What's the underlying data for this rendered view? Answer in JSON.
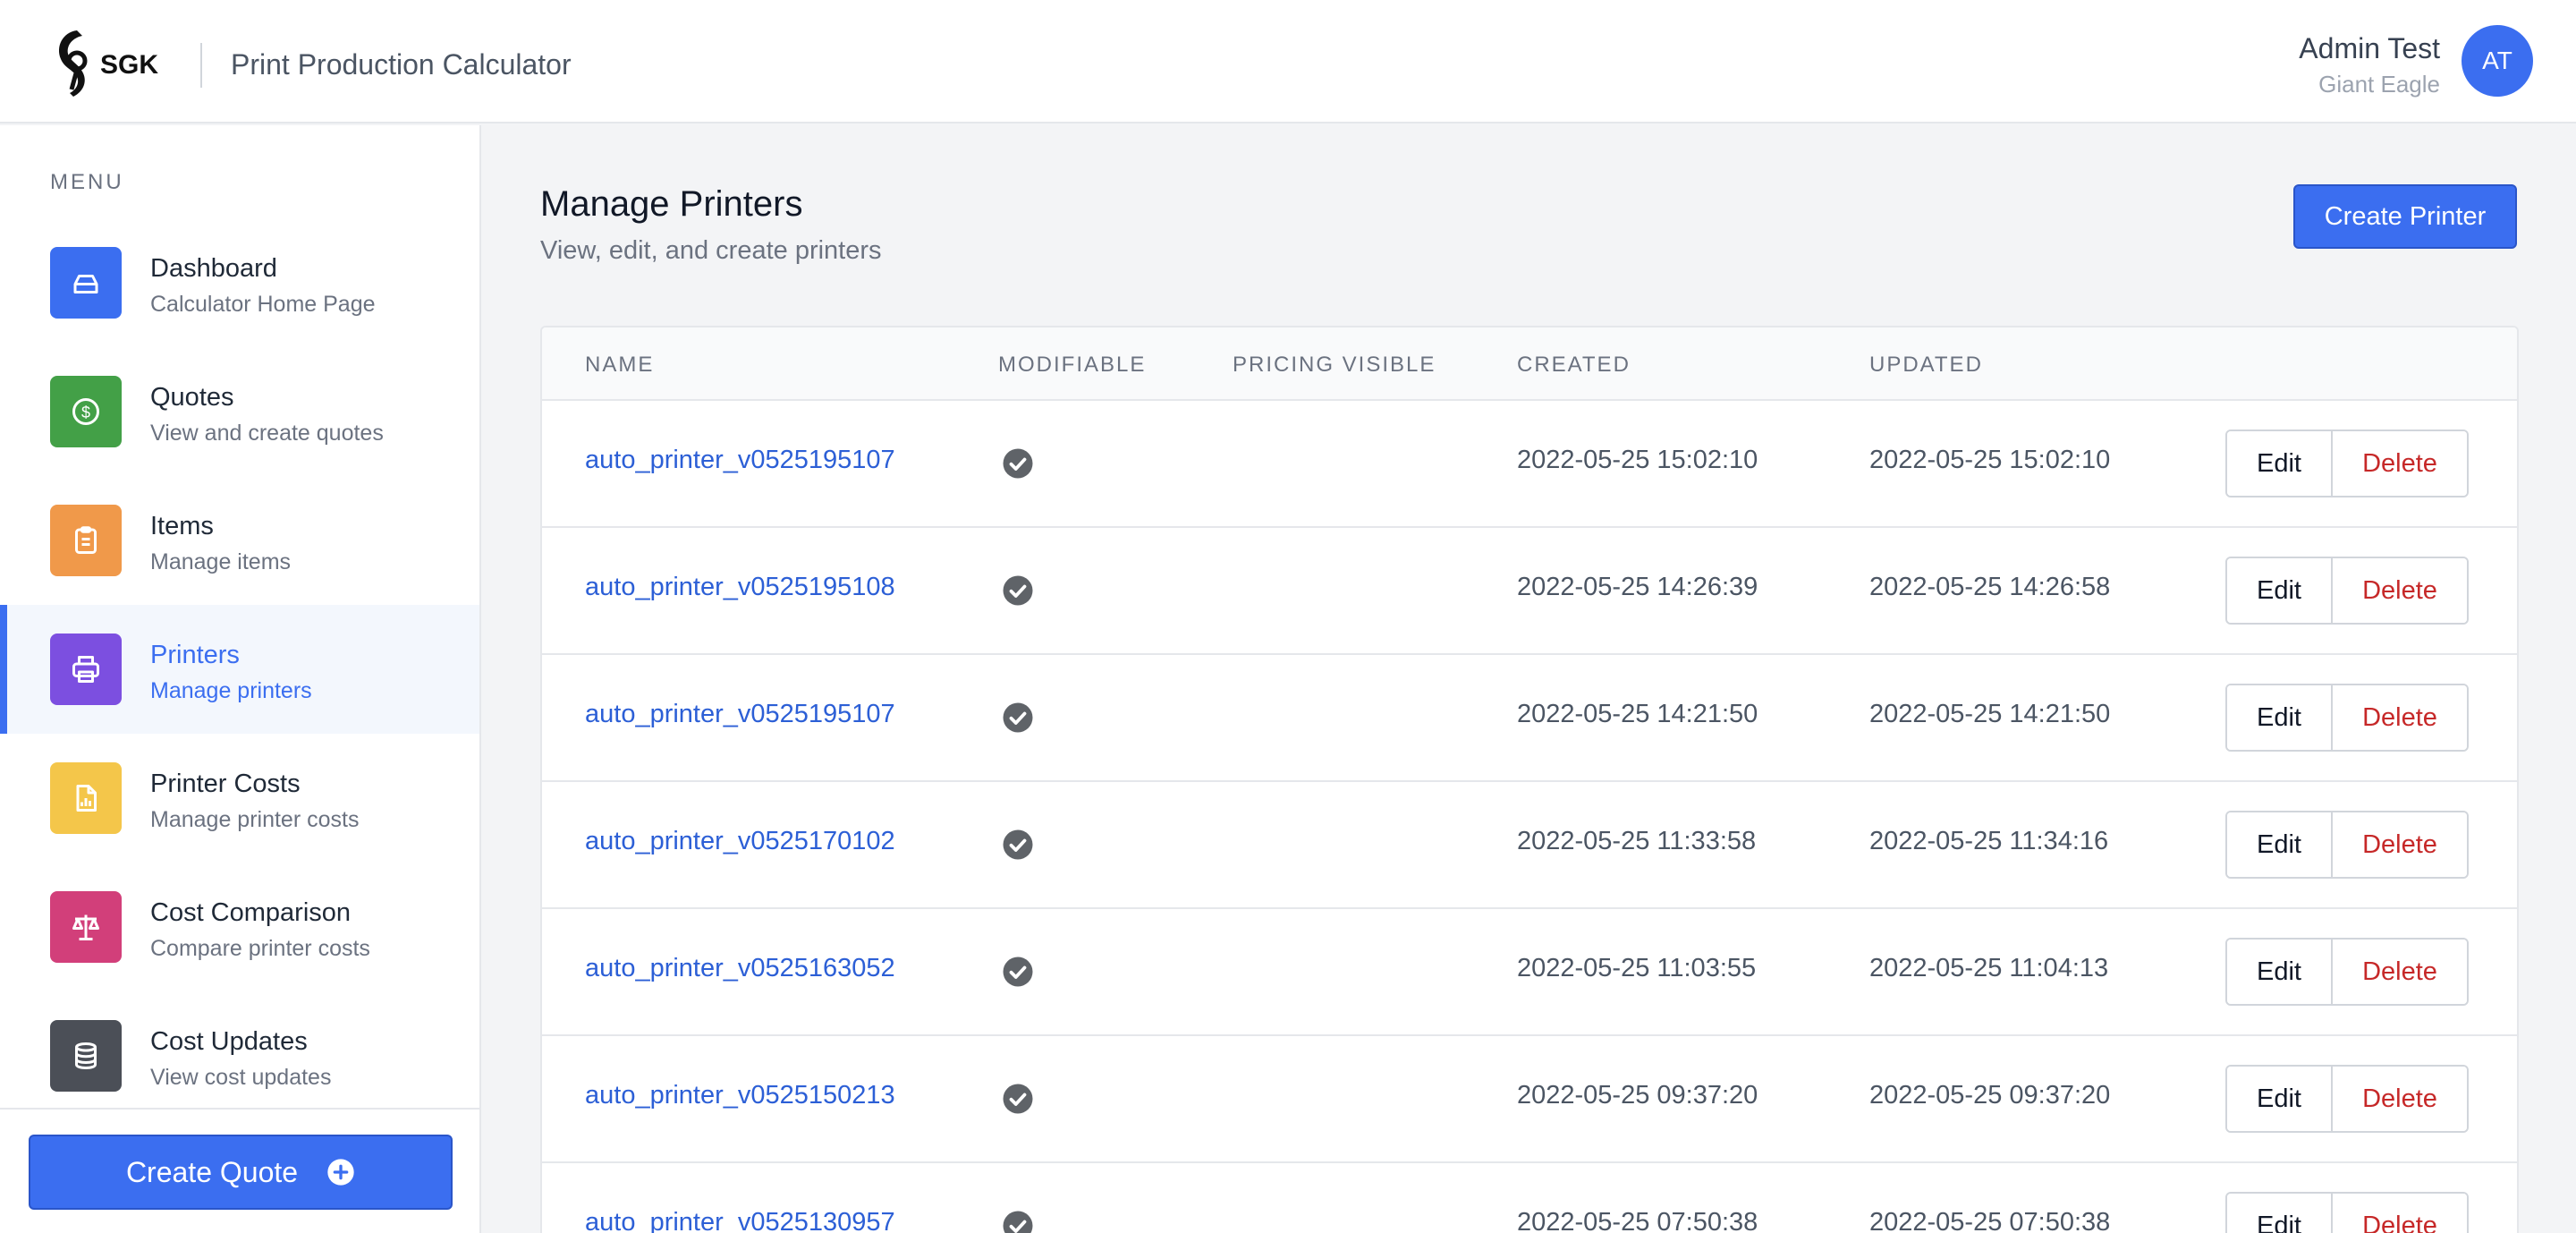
{
  "header": {
    "logo_text": "SGK",
    "app_title": "Print Production Calculator",
    "user_name": "Admin Test",
    "user_org": "Giant Eagle",
    "avatar_initials": "AT"
  },
  "sidebar": {
    "menu_label": "MENU",
    "items": [
      {
        "title": "Dashboard",
        "subtitle": "Calculator Home Page",
        "icon": "home-icon",
        "color": "#3b6ef0"
      },
      {
        "title": "Quotes",
        "subtitle": "View and create quotes",
        "icon": "currency-dollar-icon",
        "color": "#43a047"
      },
      {
        "title": "Items",
        "subtitle": "Manage items",
        "icon": "clipboard-list-icon",
        "color": "#f0994a"
      },
      {
        "title": "Printers",
        "subtitle": "Manage printers",
        "icon": "printer-icon",
        "color": "#7c4fe0",
        "active": true
      },
      {
        "title": "Printer Costs",
        "subtitle": "Manage printer costs",
        "icon": "document-chart-icon",
        "color": "#f4c64a"
      },
      {
        "title": "Cost Comparison",
        "subtitle": "Compare printer costs",
        "icon": "scale-icon",
        "color": "#d23f7a"
      },
      {
        "title": "Cost Updates",
        "subtitle": "View cost updates",
        "icon": "database-icon",
        "color": "#4b4f57"
      }
    ],
    "create_quote_label": "Create Quote"
  },
  "main": {
    "title": "Manage Printers",
    "subtitle": "View, edit, and create printers",
    "create_button_label": "Create Printer",
    "table": {
      "columns": [
        "NAME",
        "MODIFIABLE",
        "PRICING VISIBLE",
        "CREATED",
        "UPDATED"
      ],
      "edit_label": "Edit",
      "delete_label": "Delete",
      "rows": [
        {
          "name": "auto_printer_v0525195107",
          "modifiable": true,
          "pricing_visible": false,
          "created": "2022-05-25 15:02:10",
          "updated": "2022-05-25 15:02:10"
        },
        {
          "name": "auto_printer_v0525195108",
          "modifiable": true,
          "pricing_visible": false,
          "created": "2022-05-25 14:26:39",
          "updated": "2022-05-25 14:26:58"
        },
        {
          "name": "auto_printer_v0525195107",
          "modifiable": true,
          "pricing_visible": false,
          "created": "2022-05-25 14:21:50",
          "updated": "2022-05-25 14:21:50"
        },
        {
          "name": "auto_printer_v0525170102",
          "modifiable": true,
          "pricing_visible": false,
          "created": "2022-05-25 11:33:58",
          "updated": "2022-05-25 11:34:16"
        },
        {
          "name": "auto_printer_v0525163052",
          "modifiable": true,
          "pricing_visible": false,
          "created": "2022-05-25 11:03:55",
          "updated": "2022-05-25 11:04:13"
        },
        {
          "name": "auto_printer_v0525150213",
          "modifiable": true,
          "pricing_visible": false,
          "created": "2022-05-25 09:37:20",
          "updated": "2022-05-25 09:37:20"
        },
        {
          "name": "auto_printer_v0525130957",
          "modifiable": true,
          "pricing_visible": false,
          "created": "2022-05-25 07:50:38",
          "updated": "2022-05-25 07:50:38"
        }
      ]
    }
  }
}
